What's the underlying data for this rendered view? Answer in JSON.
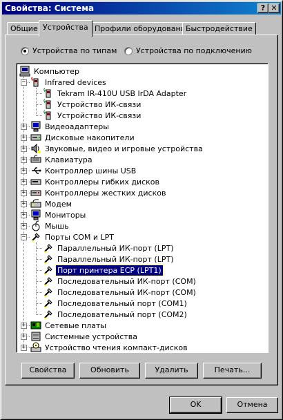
{
  "window": {
    "title": "Свойства: Система",
    "help_label": "?",
    "close_label": "✕"
  },
  "tabs": [
    {
      "label": "Общие"
    },
    {
      "label": "Устройства"
    },
    {
      "label": "Профили оборудования"
    },
    {
      "label": "Быстродействие"
    }
  ],
  "view_mode": {
    "by_type": "Устройства по типам",
    "by_connection": "Устройства по подключению",
    "selected": "by_type"
  },
  "tree": [
    {
      "label": "Компьютер",
      "level": 0,
      "icon": "computer-icon"
    },
    {
      "label": "Infrared devices",
      "level": 1,
      "icon": "infrared-icon",
      "expander": "−"
    },
    {
      "label": "Tekram IR-410U USB IrDA Adapter",
      "level": 2,
      "icon": "infrared-device-icon"
    },
    {
      "label": "Устройство ИК-связи",
      "level": 2,
      "icon": "infrared-device-icon"
    },
    {
      "label": "Устройство ИК-связи",
      "level": 2,
      "icon": "infrared-device-icon"
    },
    {
      "label": "Видеоадаптеры",
      "level": 1,
      "icon": "monitor-icon",
      "expander": "+"
    },
    {
      "label": "Дисковые накопители",
      "level": 1,
      "icon": "disk-drive-icon",
      "expander": "+"
    },
    {
      "label": "Звуковые, видео и игровые устройства",
      "level": 1,
      "icon": "sound-icon",
      "expander": "+"
    },
    {
      "label": "Клавиатура",
      "level": 1,
      "icon": "keyboard-icon",
      "expander": "+"
    },
    {
      "label": "Контроллер шины USB",
      "level": 1,
      "icon": "usb-icon",
      "expander": "+"
    },
    {
      "label": "Контроллеры гибких дисков",
      "level": 1,
      "icon": "floppy-controller-icon",
      "expander": "+"
    },
    {
      "label": "Контроллеры жестких дисков",
      "level": 1,
      "icon": "hdd-controller-icon",
      "expander": "+"
    },
    {
      "label": "Модем",
      "level": 1,
      "icon": "modem-icon",
      "expander": "+"
    },
    {
      "label": "Мониторы",
      "level": 1,
      "icon": "monitor-icon",
      "expander": "+"
    },
    {
      "label": "Мышь",
      "level": 1,
      "icon": "mouse-icon",
      "expander": "+"
    },
    {
      "label": "Порты COM и LPT",
      "level": 1,
      "icon": "port-icon",
      "expander": "−"
    },
    {
      "label": "Параллельный ИК-порт (LPT)",
      "level": 2,
      "icon": "port-icon"
    },
    {
      "label": "Параллельный ИК-порт (LPT)",
      "level": 2,
      "icon": "port-icon"
    },
    {
      "label": "Порт принтера ECP (LPT1)",
      "level": 2,
      "icon": "port-icon",
      "selected": true
    },
    {
      "label": "Последовательный ИК-порт (COM)",
      "level": 2,
      "icon": "port-icon"
    },
    {
      "label": "Последовательный ИК-порт (COM)",
      "level": 2,
      "icon": "port-icon"
    },
    {
      "label": "Последовательный порт (COM1)",
      "level": 2,
      "icon": "port-icon"
    },
    {
      "label": "Последовательный порт (COM2)",
      "level": 2,
      "icon": "port-icon"
    },
    {
      "label": "Сетевые платы",
      "level": 1,
      "icon": "network-card-icon",
      "expander": "+"
    },
    {
      "label": "Системные устройства",
      "level": 1,
      "icon": "system-device-icon",
      "expander": "+"
    },
    {
      "label": "Устройство чтения компакт-дисков",
      "level": 1,
      "icon": "cdrom-icon",
      "expander": "+"
    }
  ],
  "panel_buttons": {
    "properties": "Свойства",
    "refresh": "Обновить",
    "remove": "Удалить",
    "print": "Печать..."
  },
  "dialog_buttons": {
    "ok": "OK",
    "cancel": "Отмена"
  }
}
